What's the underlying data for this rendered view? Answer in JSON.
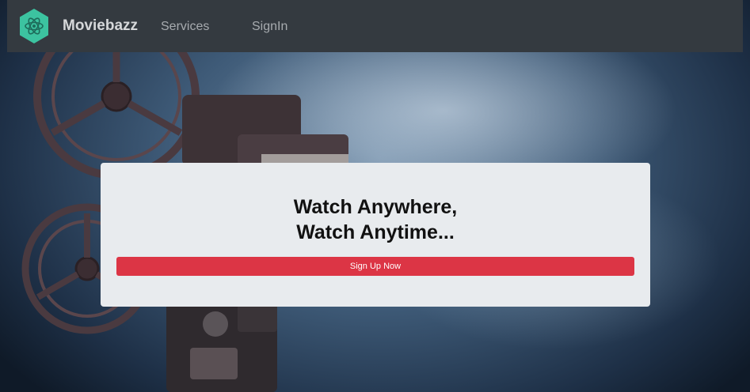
{
  "navbar": {
    "brand": "Moviebazz",
    "links": [
      {
        "label": "Services"
      },
      {
        "label": "SignIn"
      }
    ],
    "logo_icon": "atom-hexagon-icon",
    "logo_color": "#3cc3a0"
  },
  "hero": {
    "title_line1": "Watch Anywhere,",
    "title_line2": "Watch Anytime...",
    "signup_label": "Sign Up Now",
    "signup_color": "#dc3545"
  }
}
